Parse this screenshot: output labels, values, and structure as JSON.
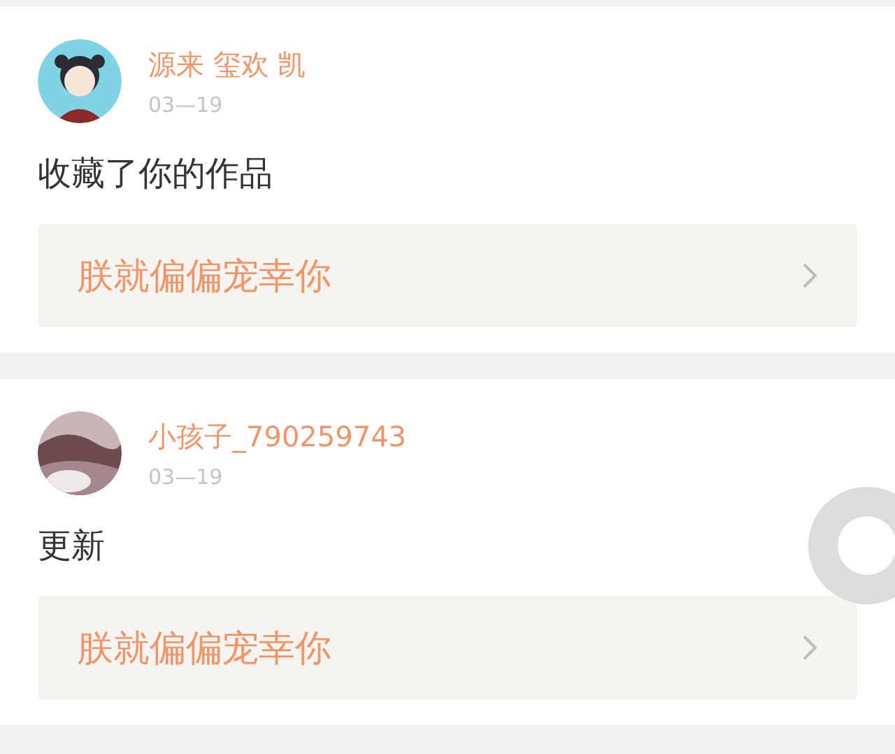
{
  "posts": [
    {
      "name": "源来 玺欢 凯",
      "date": "03—19",
      "content": "收藏了你的作品",
      "work_title": "朕就偏偏宠幸你"
    },
    {
      "name": "小孩子_790259743",
      "date": "03—19",
      "content": "更新",
      "work_title": "朕就偏偏宠幸你"
    }
  ]
}
